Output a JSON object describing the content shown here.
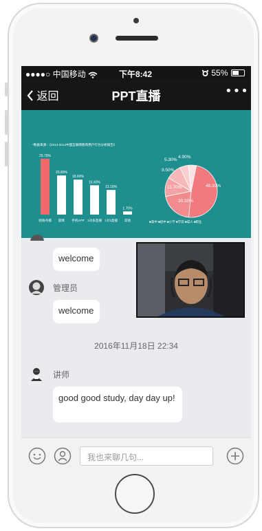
{
  "status_bar": {
    "signal": "●●●●○",
    "carrier": "中国移动",
    "wifi_icon": "wifi",
    "time": "下午8:42",
    "alarm_icon": "alarm-clock",
    "battery": "55%",
    "battery_level": 0.55
  },
  "nav": {
    "back_label": "返回",
    "title": "PPT直播",
    "more_label": "•••"
  },
  "slide": {
    "caption": "*数据来源：《2013-2014中国互联网教育用户行为分析报告》",
    "bars": [
      {
        "label": "组络点播",
        "value_label": "29.70%",
        "value": 29.7,
        "color": "#f06a6a"
      },
      {
        "label": "题库",
        "value_label": "20.80%",
        "value": 20.8,
        "color": "#ffffff"
      },
      {
        "label": "手机APP",
        "value_label": "18.60%",
        "value": 18.6,
        "color": "#ffffff"
      },
      {
        "label": "1对多直播",
        "value_label": "15.60%",
        "value": 15.6,
        "color": "#ffffff"
      },
      {
        "label": "1对1直播",
        "value_label": "13.10%",
        "value": 13.1,
        "color": "#ffffff"
      },
      {
        "label": "其他",
        "value_label": "1.70%",
        "value": 1.7,
        "color": "#ffffff"
      }
    ],
    "pie": [
      {
        "label": "48.30%",
        "value": 48.3,
        "color": "#f07a7e"
      },
      {
        "label": "20.30%",
        "value": 20.3,
        "color": "#f28b8e"
      },
      {
        "label": "11.70%",
        "value": 11.7,
        "color": "#f4a3a5"
      },
      {
        "label": "9.50%",
        "value": 9.5,
        "color": "#f6b8b9"
      },
      {
        "label": "5.30%",
        "value": 5.3,
        "color": "#f9cfd0"
      },
      {
        "label": "4.90%",
        "value": 4.9,
        "color": "#fbe2e2"
      }
    ],
    "pie_legend": [
      "■高中",
      "■初中",
      "■小学",
      "■学前",
      "■成人",
      "■职业"
    ]
  },
  "messages": [
    {
      "sender": "",
      "text": "welcome"
    },
    {
      "sender": "管理员",
      "text": "welcome"
    }
  ],
  "timestamp": "2016年11月18日 22:34",
  "lecturer_message": {
    "sender": "讲师",
    "text": "good good study, day day up!"
  },
  "input": {
    "placeholder": "我也来聊几句..."
  },
  "colors": {
    "bar_accent": "#f06a6a",
    "slide_bg": "#1f8e8f",
    "nav_bg": "#161616"
  }
}
